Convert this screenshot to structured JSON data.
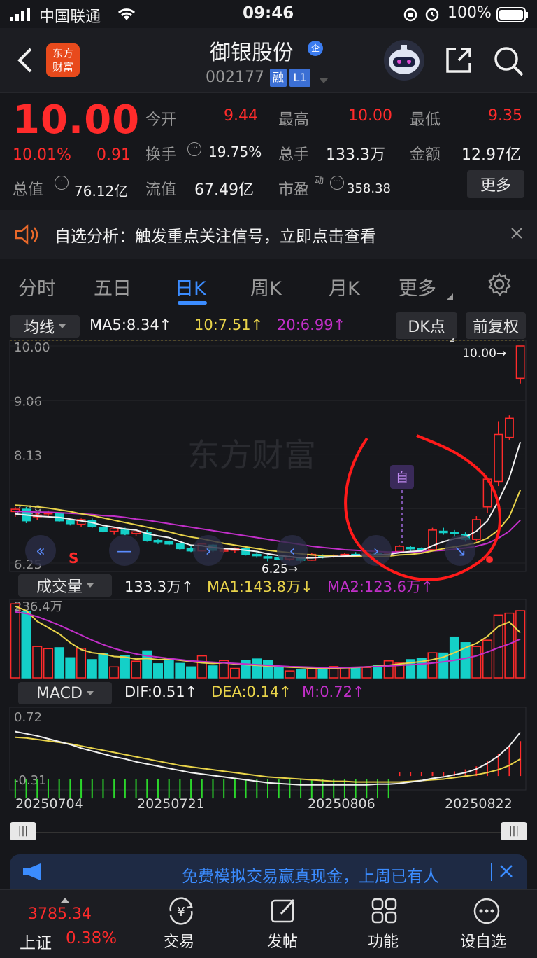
{
  "status_bar": {
    "carrier": "中国联通",
    "time": "09:46",
    "battery": "100%"
  },
  "header": {
    "title": "御银股份",
    "code": "002177",
    "badge_rong": "融",
    "badge_level": "L1",
    "logo_text": "东方\n财富"
  },
  "quote": {
    "price": "10.00",
    "change_pct": "10.01%",
    "change_amt": "0.91",
    "open_label": "今开",
    "open": "9.44",
    "high_label": "最高",
    "high": "10.00",
    "low_label": "最低",
    "low": "9.35",
    "turnover_label": "换手",
    "turnover": "19.75%",
    "volume_label": "总手",
    "volume": "133.3万",
    "amount_label": "金额",
    "amount": "12.97亿",
    "mktcap_label": "总值",
    "mktcap": "76.12亿",
    "float_label": "流值",
    "float": "67.49亿",
    "pe_label": "市盈",
    "pe_sup": "动",
    "pe": "358.38",
    "more_label": "更多"
  },
  "banner": {
    "text": "自选分析：触发重点关注信号，立即点击查看"
  },
  "tabs": {
    "items": [
      "分时",
      "五日",
      "日K",
      "周K",
      "月K",
      "更多"
    ],
    "active": 2
  },
  "kline": {
    "indicator_select": "均线",
    "ma5": "MA5:8.34↑",
    "ma10": "10:7.51↑",
    "ma20": "20:6.99↑",
    "dk_label": "DK点",
    "adjust_label": "前复权",
    "y_labels": [
      "10.00",
      "9.06",
      "8.13",
      "7.19",
      "6.25"
    ],
    "max_label": "10.00→",
    "min_label": "6.25→",
    "s_marker": "S",
    "zi_marker": "自",
    "watermark": "东方财富"
  },
  "volume": {
    "select": "成交量",
    "value": "133.3万↑",
    "ma1": "MA1:143.8万↓",
    "ma2": "MA2:123.6万↑",
    "y_label": "236.4万"
  },
  "macd": {
    "select": "MACD",
    "dif": "DIF:0.51↑",
    "dea": "DEA:0.14↑",
    "m": "M:0.72↑",
    "y_top": "0.72",
    "y_bottom": "-0.31"
  },
  "dates": [
    "20250704",
    "20250721",
    "20250806",
    "20250822"
  ],
  "promo": {
    "text": "免费模拟交易赢真现金，上周已有人"
  },
  "bottom_nav": {
    "index_value": "3785.34",
    "index_name": "上证",
    "index_pct": "0.38%",
    "items": [
      "交易",
      "发帖",
      "功能",
      "设自选"
    ]
  },
  "colors": {
    "up": "#ff2b2b",
    "down": "#14d0c8",
    "ma5": "#f0f0f0",
    "ma10": "#e8d34a",
    "ma20": "#c22fc9",
    "accent": "#3b8cff"
  },
  "chart_data": {
    "type": "candlestick",
    "candles": [
      [
        7.14,
        7.22,
        7.05,
        7.18
      ],
      [
        7.18,
        7.22,
        6.94,
        6.98
      ],
      [
        7.05,
        7.12,
        7.0,
        7.08
      ],
      [
        7.1,
        7.16,
        7.06,
        7.13
      ],
      [
        7.1,
        7.12,
        6.96,
        6.98
      ],
      [
        6.98,
        7.0,
        6.9,
        6.93
      ],
      [
        6.92,
        7.02,
        6.88,
        7.0
      ],
      [
        6.98,
        7.02,
        6.86,
        6.88
      ],
      [
        6.86,
        6.9,
        6.78,
        6.8
      ],
      [
        6.8,
        6.86,
        6.74,
        6.84
      ],
      [
        6.82,
        6.86,
        6.73,
        6.75
      ],
      [
        6.76,
        6.8,
        6.72,
        6.79
      ],
      [
        6.78,
        6.82,
        6.62,
        6.64
      ],
      [
        6.64,
        6.66,
        6.58,
        6.62
      ],
      [
        6.62,
        6.64,
        6.56,
        6.58
      ],
      [
        6.58,
        6.6,
        6.48,
        6.5
      ],
      [
        6.5,
        6.54,
        6.44,
        6.46
      ],
      [
        6.46,
        6.6,
        6.45,
        6.58
      ],
      [
        6.56,
        6.58,
        6.44,
        6.47
      ],
      [
        6.46,
        6.5,
        6.42,
        6.48
      ],
      [
        6.47,
        6.52,
        6.42,
        6.5
      ],
      [
        6.5,
        6.54,
        6.38,
        6.4
      ],
      [
        6.4,
        6.44,
        6.34,
        6.38
      ],
      [
        6.36,
        6.4,
        6.28,
        6.34
      ],
      [
        6.34,
        6.38,
        6.3,
        6.32
      ],
      [
        6.32,
        6.38,
        6.29,
        6.36
      ],
      [
        6.34,
        6.36,
        6.25,
        6.3
      ],
      [
        6.3,
        6.42,
        6.29,
        6.4
      ],
      [
        6.38,
        6.4,
        6.33,
        6.36
      ],
      [
        6.36,
        6.4,
        6.34,
        6.38
      ],
      [
        6.38,
        6.42,
        6.35,
        6.4
      ],
      [
        6.4,
        6.44,
        6.37,
        6.38
      ],
      [
        6.38,
        6.42,
        6.36,
        6.41
      ],
      [
        6.42,
        6.46,
        6.38,
        6.4
      ],
      [
        6.4,
        6.44,
        6.37,
        6.42
      ],
      [
        6.45,
        6.56,
        6.43,
        6.54
      ],
      [
        6.52,
        6.55,
        6.46,
        6.5
      ],
      [
        6.5,
        6.52,
        6.46,
        6.48
      ],
      [
        6.48,
        6.86,
        6.47,
        6.82
      ],
      [
        6.8,
        6.86,
        6.74,
        6.78
      ],
      [
        6.78,
        6.82,
        6.7,
        6.76
      ],
      [
        6.74,
        6.78,
        6.62,
        6.66
      ],
      [
        6.66,
        7.06,
        6.62,
        7.0
      ],
      [
        7.22,
        7.72,
        7.12,
        7.7
      ],
      [
        7.66,
        8.7,
        7.58,
        8.47
      ],
      [
        8.42,
        8.8,
        8.38,
        8.75
      ],
      [
        9.44,
        10.0,
        9.35,
        10.0
      ]
    ],
    "ma5": [
      7.1,
      7.08,
      7.06,
      7.05,
      7.04,
      7.01,
      6.98,
      6.95,
      6.9,
      6.87,
      6.84,
      6.82,
      6.76,
      6.72,
      6.69,
      6.62,
      6.56,
      6.55,
      6.52,
      6.5,
      6.49,
      6.47,
      6.45,
      6.41,
      6.38,
      6.36,
      6.34,
      6.34,
      6.35,
      6.36,
      6.37,
      6.38,
      6.39,
      6.39,
      6.4,
      6.43,
      6.45,
      6.46,
      6.55,
      6.62,
      6.67,
      6.7,
      6.8,
      6.98,
      7.32,
      7.72,
      8.34
    ],
    "ma10": [
      7.25,
      7.24,
      7.22,
      7.2,
      7.17,
      7.14,
      7.1,
      7.07,
      7.03,
      6.99,
      6.95,
      6.91,
      6.87,
      6.83,
      6.79,
      6.74,
      6.7,
      6.67,
      6.63,
      6.59,
      6.56,
      6.53,
      6.5,
      6.47,
      6.45,
      6.43,
      6.41,
      6.39,
      6.38,
      6.37,
      6.36,
      6.36,
      6.36,
      6.36,
      6.37,
      6.39,
      6.4,
      6.42,
      6.46,
      6.5,
      6.53,
      6.56,
      6.6,
      6.68,
      6.82,
      7.05,
      7.51
    ],
    "ma20": [
      7.14,
      7.14,
      7.13,
      7.13,
      7.12,
      7.11,
      7.1,
      7.09,
      7.07,
      7.06,
      7.04,
      7.01,
      6.99,
      6.96,
      6.93,
      6.9,
      6.87,
      6.84,
      6.81,
      6.78,
      6.75,
      6.72,
      6.69,
      6.66,
      6.63,
      6.6,
      6.57,
      6.54,
      6.52,
      6.5,
      6.48,
      6.47,
      6.46,
      6.45,
      6.44,
      6.44,
      6.44,
      6.45,
      6.46,
      6.47,
      6.49,
      6.51,
      6.54,
      6.59,
      6.68,
      6.8,
      6.99
    ],
    "volume": [
      236,
      212,
      100,
      93,
      96,
      64,
      94,
      58,
      78,
      35,
      70,
      53,
      86,
      45,
      54,
      46,
      35,
      70,
      38,
      55,
      30,
      55,
      60,
      55,
      33,
      22,
      27,
      30,
      30,
      36,
      32,
      31,
      33,
      40,
      54,
      47,
      58,
      62,
      80,
      79,
      130,
      112,
      100,
      120,
      200,
      206,
      214,
      174
    ],
    "volume_ma1": [
      228,
      214,
      180,
      160,
      140,
      112,
      90,
      80,
      76,
      68,
      66,
      60,
      62,
      58,
      60,
      56,
      52,
      48,
      46,
      48,
      44,
      42,
      40,
      38,
      36,
      34,
      33,
      31,
      30,
      31,
      32,
      33,
      35,
      37,
      40,
      44,
      48,
      52,
      58,
      66,
      80,
      96,
      110,
      132,
      164,
      178,
      143.8
    ],
    "volume_ma2": [
      210,
      205,
      195,
      182,
      168,
      152,
      136,
      120,
      106,
      94,
      84,
      76,
      70,
      66,
      62,
      58,
      54,
      52,
      50,
      48,
      46,
      44,
      42,
      40,
      38,
      36,
      35,
      34,
      33,
      33,
      33,
      34,
      35,
      36,
      38,
      40,
      42,
      44,
      47,
      51,
      56,
      62,
      70,
      82,
      96,
      108,
      123.6
    ],
    "macd": [
      0.02,
      0.03,
      0.04,
      0.05,
      0.06,
      0.06,
      0.06,
      0.06,
      0.07,
      0.07,
      0.07,
      0.06,
      0.05,
      0.05,
      0.05,
      0.04,
      0.04,
      0.04,
      0.03,
      0.03,
      0.03,
      0.02,
      0.02,
      0.02,
      0.01,
      0.01,
      0.01,
      0.01,
      0.01,
      0.01,
      0.01,
      0.01,
      0.01,
      0.01,
      0.02,
      0.03,
      0.04,
      0.06,
      0.08,
      0.1,
      0.12,
      0.16,
      0.22,
      0.32,
      0.46,
      0.62,
      0.72
    ],
    "macd_dif": [
      0.52,
      0.49,
      0.46,
      0.42,
      0.38,
      0.34,
      0.29,
      0.25,
      0.21,
      0.17,
      0.14,
      0.1,
      0.07,
      0.04,
      0.01,
      -0.02,
      -0.05,
      -0.07,
      -0.09,
      -0.11,
      -0.13,
      -0.15,
      -0.17,
      -0.19,
      -0.2,
      -0.21,
      -0.22,
      -0.22,
      -0.22,
      -0.22,
      -0.22,
      -0.22,
      -0.22,
      -0.21,
      -0.21,
      -0.2,
      -0.18,
      -0.16,
      -0.13,
      -0.11,
      -0.08,
      -0.05,
      0.0,
      0.08,
      0.18,
      0.32,
      0.51
    ],
    "macd_dea": [
      0.44,
      0.43,
      0.41,
      0.39,
      0.37,
      0.35,
      0.32,
      0.29,
      0.26,
      0.23,
      0.2,
      0.17,
      0.14,
      0.11,
      0.08,
      0.05,
      0.03,
      0.01,
      -0.01,
      -0.03,
      -0.05,
      -0.07,
      -0.09,
      -0.11,
      -0.12,
      -0.13,
      -0.14,
      -0.15,
      -0.16,
      -0.17,
      -0.17,
      -0.18,
      -0.18,
      -0.18,
      -0.18,
      -0.18,
      -0.17,
      -0.16,
      -0.15,
      -0.14,
      -0.12,
      -0.1,
      -0.08,
      -0.05,
      -0.01,
      0.05,
      0.14
    ],
    "price_range": [
      6.25,
      10.0
    ],
    "volume_max": 236.4,
    "macd_range": [
      -0.31,
      0.72
    ]
  }
}
